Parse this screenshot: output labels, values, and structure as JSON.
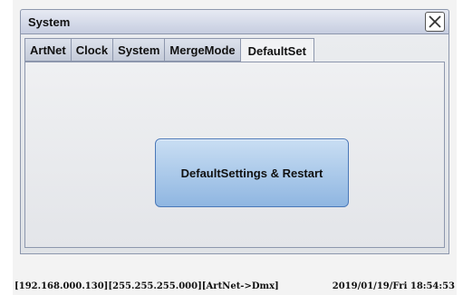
{
  "window": {
    "title": "System"
  },
  "tabs": [
    {
      "label": "ArtNet"
    },
    {
      "label": "Clock"
    },
    {
      "label": "System"
    },
    {
      "label": "MergeMode"
    },
    {
      "label": "DefaultSet",
      "active": true
    }
  ],
  "panel": {
    "reset_button_label": "DefaultSettings & Restart"
  },
  "status_bar": {
    "network": "[192.168.000.130][255.255.255.000][ArtNet->Dmx]",
    "datetime": "2019/01/19/Fri 18:54:53"
  },
  "icons": {
    "close": "close-icon"
  },
  "colors": {
    "title_bar": "#c6cde0",
    "button_fill": "#8fb6e1",
    "button_border": "#4a78b8"
  }
}
